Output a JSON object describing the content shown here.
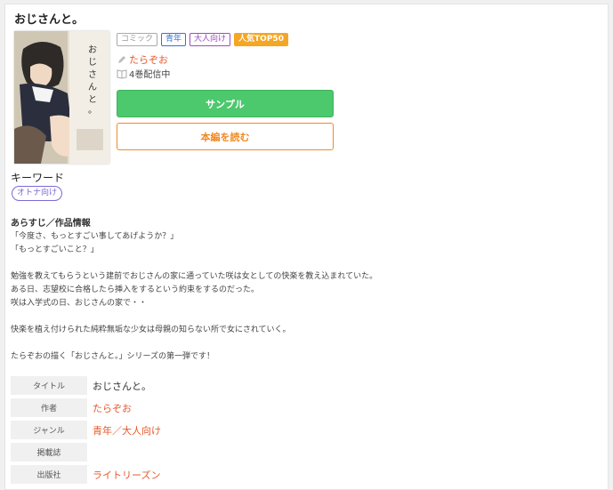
{
  "title": "おじさんと。",
  "tags": [
    {
      "label": "コミック"
    },
    {
      "label": "青年"
    },
    {
      "label": "大人向け"
    },
    {
      "label": "人気TOP50"
    }
  ],
  "author": "たらぞお",
  "volumes": "4巻配信中",
  "buttons": {
    "sample": "サンプル",
    "read": "本編を読む"
  },
  "keywords": {
    "heading": "キーワード",
    "items": [
      "オトナ向け"
    ]
  },
  "synopsis": {
    "heading": "あらすじ／作品情報",
    "lines": [
      "「今度さ、もっとすごい事してあげようか？」",
      "「もっとすごいこと？」",
      "",
      "勉強を教えてもらうという建前でおじさんの家に通っていた咲は女としての快楽を教え込まれていた。",
      "ある日、志望校に合格したら挿入をするという約束をするのだった。",
      "咲は入学式の日、おじさんの家で・・",
      "",
      "快楽を植え付けられた純粋無垢な少女は母親の知らない所で女にされていく。",
      "",
      "たらぞおの描く「おじさんと。」シリーズの第一弾です！"
    ]
  },
  "info": {
    "rows": [
      {
        "key": "タイトル",
        "value": "おじさんと。"
      },
      {
        "key": "作者",
        "value": "たらぞお"
      },
      {
        "key": "ジャンル",
        "value": "青年／大人向け"
      },
      {
        "key": "掲載誌",
        "value": ""
      },
      {
        "key": "出版社",
        "value": "ライトリーズン"
      }
    ]
  },
  "colors": {
    "accent_link": "#e8572a",
    "sample_button": "#4cc86d",
    "read_button": "#f08a24",
    "top_badge": "#f5a623"
  }
}
